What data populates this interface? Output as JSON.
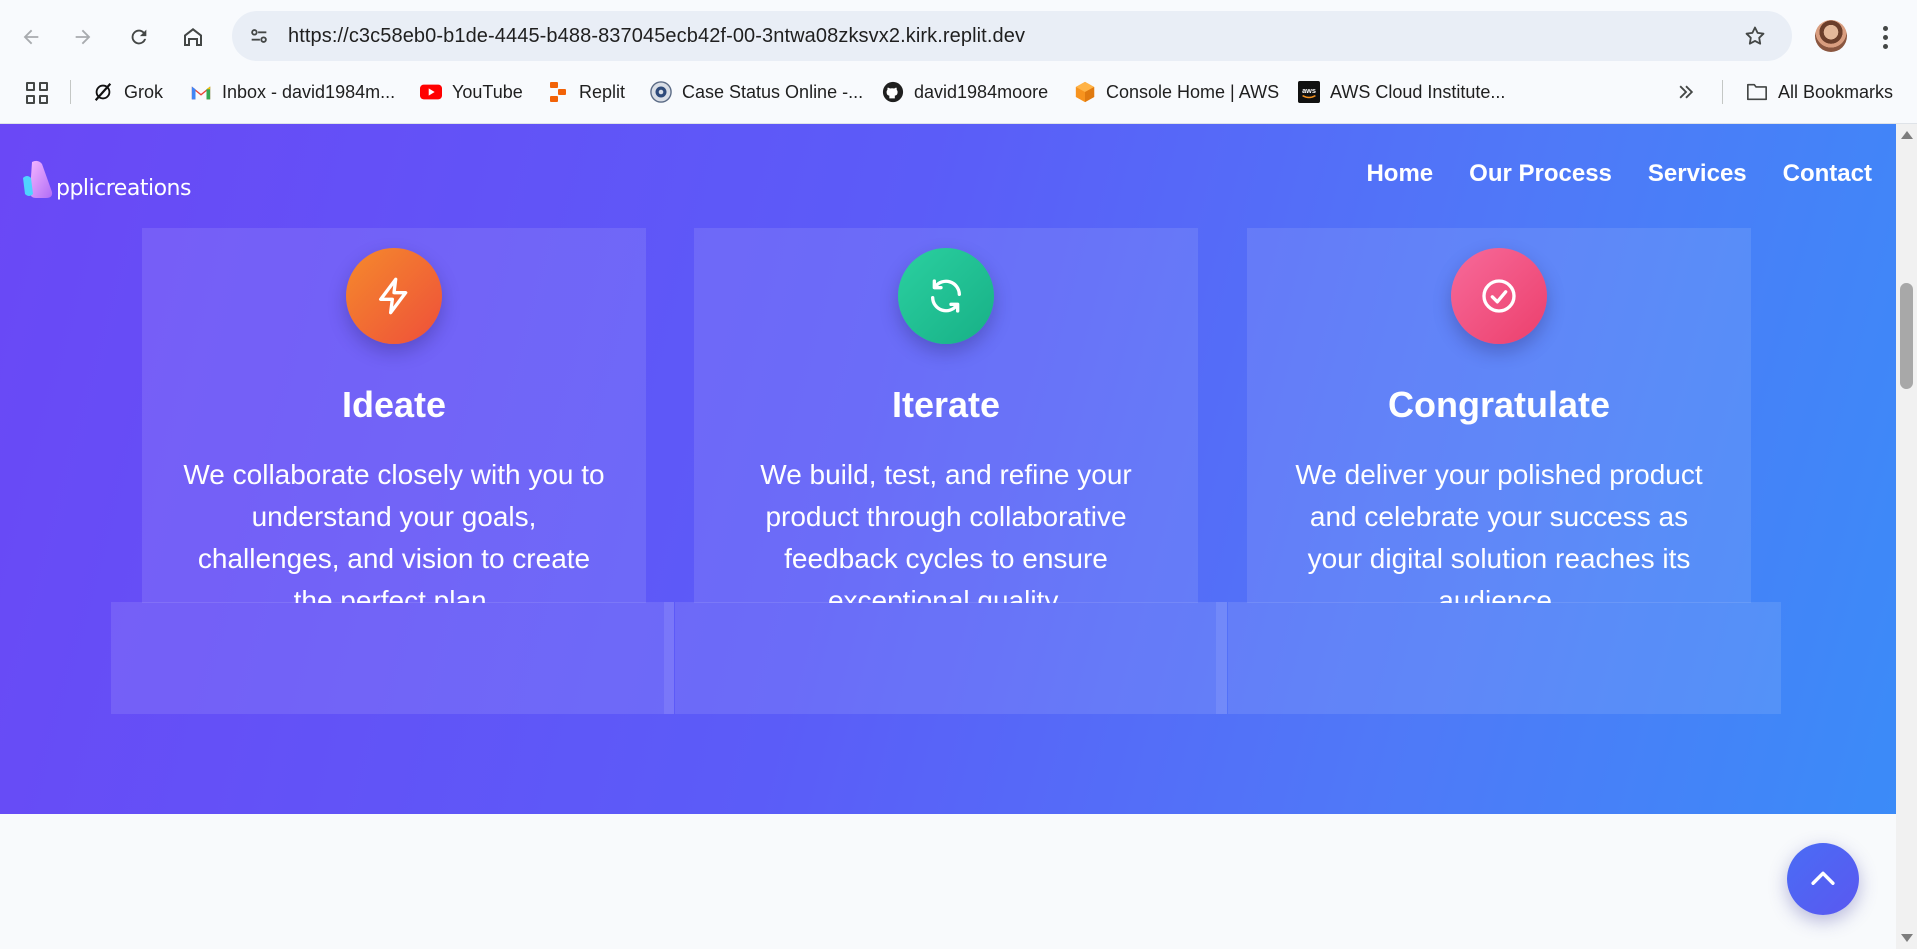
{
  "browser": {
    "url": "https://c3c58eb0-b1de-4445-b488-837045ecb42f-00-3ntwa08zksvx2.kirk.replit.dev",
    "bookmarks": [
      {
        "label": "Grok",
        "icon": "grok-icon"
      },
      {
        "label": "Inbox - david1984m...",
        "icon": "gmail-icon"
      },
      {
        "label": "YouTube",
        "icon": "youtube-icon"
      },
      {
        "label": "Replit",
        "icon": "replit-icon"
      },
      {
        "label": "Case Status Online -...",
        "icon": "uscis-seal-icon"
      },
      {
        "label": "david1984moore",
        "icon": "github-icon"
      },
      {
        "label": "Console Home | AWS",
        "icon": "aws-cube-icon"
      },
      {
        "label": "AWS Cloud Institute...",
        "icon": "aws-logo-icon"
      }
    ],
    "all_bookmarks": "All Bookmarks"
  },
  "site": {
    "logo_text": "pplicreations",
    "nav": [
      "Home",
      "Our Process",
      "Services",
      "Contact"
    ]
  },
  "process": {
    "cards": [
      {
        "title": "Ideate",
        "text": "We collaborate closely with you to understand your goals, challenges, and vision to create the perfect plan.",
        "icon": "lightning-icon",
        "color": "#f26b2f"
      },
      {
        "title": "Iterate",
        "text": "We build, test, and refine your product through collaborative feedback cycles to ensure exceptional quality.",
        "icon": "refresh-icon",
        "color": "#22c08d"
      },
      {
        "title": "Congratulate",
        "text": "We deliver your polished product and celebrate your success as your digital solution reaches its audience.",
        "icon": "check-circle-icon",
        "color": "#f0517f"
      }
    ]
  },
  "colors": {
    "hero_start": "#6a48f6",
    "hero_end": "#3b8bf8",
    "scroll_button": "#4f64f3"
  }
}
